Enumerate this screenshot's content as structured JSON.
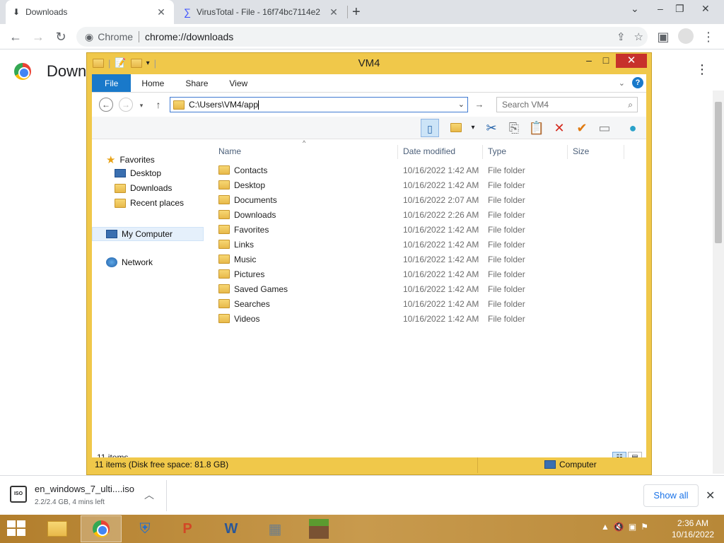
{
  "browser": {
    "tabs": [
      {
        "title": "Downloads"
      },
      {
        "title": "VirusTotal - File - 16f74bc7114e2"
      }
    ],
    "omnibox": {
      "scheme_label": "Chrome",
      "url": "chrome://downloads"
    },
    "page_title": "Down"
  },
  "explorer": {
    "title": "VM4",
    "ribbon_tabs": [
      "File",
      "Home",
      "Share",
      "View"
    ],
    "address": "C:\\Users\\VM4/app",
    "search_placeholder": "Search VM4",
    "nav": {
      "favorites": "Favorites",
      "desktop": "Desktop",
      "downloads": "Downloads",
      "recent": "Recent places",
      "computer": "My Computer",
      "network": "Network"
    },
    "columns": {
      "name": "Name",
      "date": "Date modified",
      "type": "Type",
      "size": "Size"
    },
    "rows": [
      {
        "name": "Contacts",
        "date": "10/16/2022 1:42 AM",
        "type": "File folder"
      },
      {
        "name": "Desktop",
        "date": "10/16/2022 1:42 AM",
        "type": "File folder"
      },
      {
        "name": "Documents",
        "date": "10/16/2022 2:07 AM",
        "type": "File folder"
      },
      {
        "name": "Downloads",
        "date": "10/16/2022 2:26 AM",
        "type": "File folder"
      },
      {
        "name": "Favorites",
        "date": "10/16/2022 1:42 AM",
        "type": "File folder"
      },
      {
        "name": "Links",
        "date": "10/16/2022 1:42 AM",
        "type": "File folder"
      },
      {
        "name": "Music",
        "date": "10/16/2022 1:42 AM",
        "type": "File folder"
      },
      {
        "name": "Pictures",
        "date": "10/16/2022 1:42 AM",
        "type": "File folder"
      },
      {
        "name": "Saved Games",
        "date": "10/16/2022 1:42 AM",
        "type": "File folder"
      },
      {
        "name": "Searches",
        "date": "10/16/2022 1:42 AM",
        "type": "File folder"
      },
      {
        "name": "Videos",
        "date": "10/16/2022 1:42 AM",
        "type": "File folder"
      }
    ],
    "item_count": "11 items",
    "status_detail": "11 items (Disk free space: 81.8 GB)",
    "status_location": "Computer"
  },
  "download_shelf": {
    "file_name": "en_windows_7_ulti....iso",
    "progress_text": "2.2/2.4 GB, 4 mins left",
    "progress": 0.92,
    "icon_label": "ISO",
    "show_all": "Show all"
  },
  "taskbar": {
    "apps": [
      "file-explorer-icon",
      "chrome-icon",
      "defender-icon",
      "powerpoint-icon",
      "word-icon",
      "resource-monitor-icon",
      "minecraft-icon"
    ],
    "time": "2:36 AM",
    "date": "10/16/2022"
  },
  "colors": {
    "explorer_frame": "#f0c84a",
    "file_tab": "#1979ca",
    "close_button": "#c7312b",
    "accent_link": "#1a73e8"
  }
}
